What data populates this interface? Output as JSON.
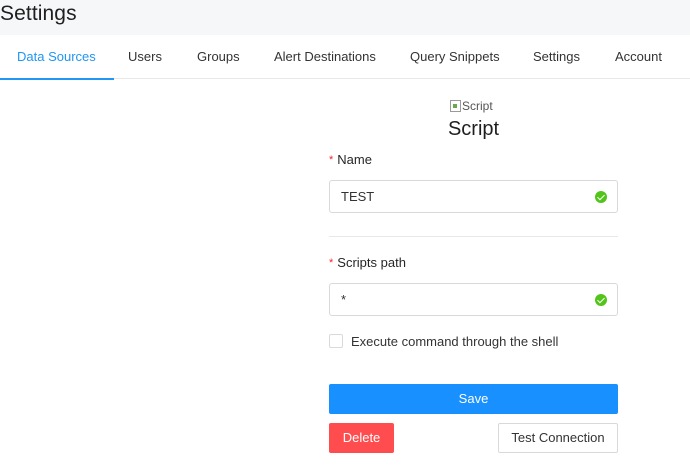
{
  "header": {
    "title": "Settings"
  },
  "tabs": [
    {
      "label": "Data Sources",
      "active": true
    },
    {
      "label": "Users"
    },
    {
      "label": "Groups"
    },
    {
      "label": "Alert Destinations"
    },
    {
      "label": "Query Snippets"
    },
    {
      "label": "Settings"
    },
    {
      "label": "Account"
    }
  ],
  "form": {
    "logo_alt": "Script",
    "title": "Script",
    "name_label": "Name",
    "name_value": "TEST",
    "path_label": "Scripts path",
    "path_value": "*",
    "shell_label": "Execute command through the shell",
    "shell_checked": false,
    "save_label": "Save",
    "delete_label": "Delete",
    "test_label": "Test Connection"
  },
  "colors": {
    "accent": "#2196f3",
    "primary_button": "#1890ff",
    "danger": "#ff4d4f",
    "valid": "#52c41a",
    "required": "#f5222d"
  }
}
